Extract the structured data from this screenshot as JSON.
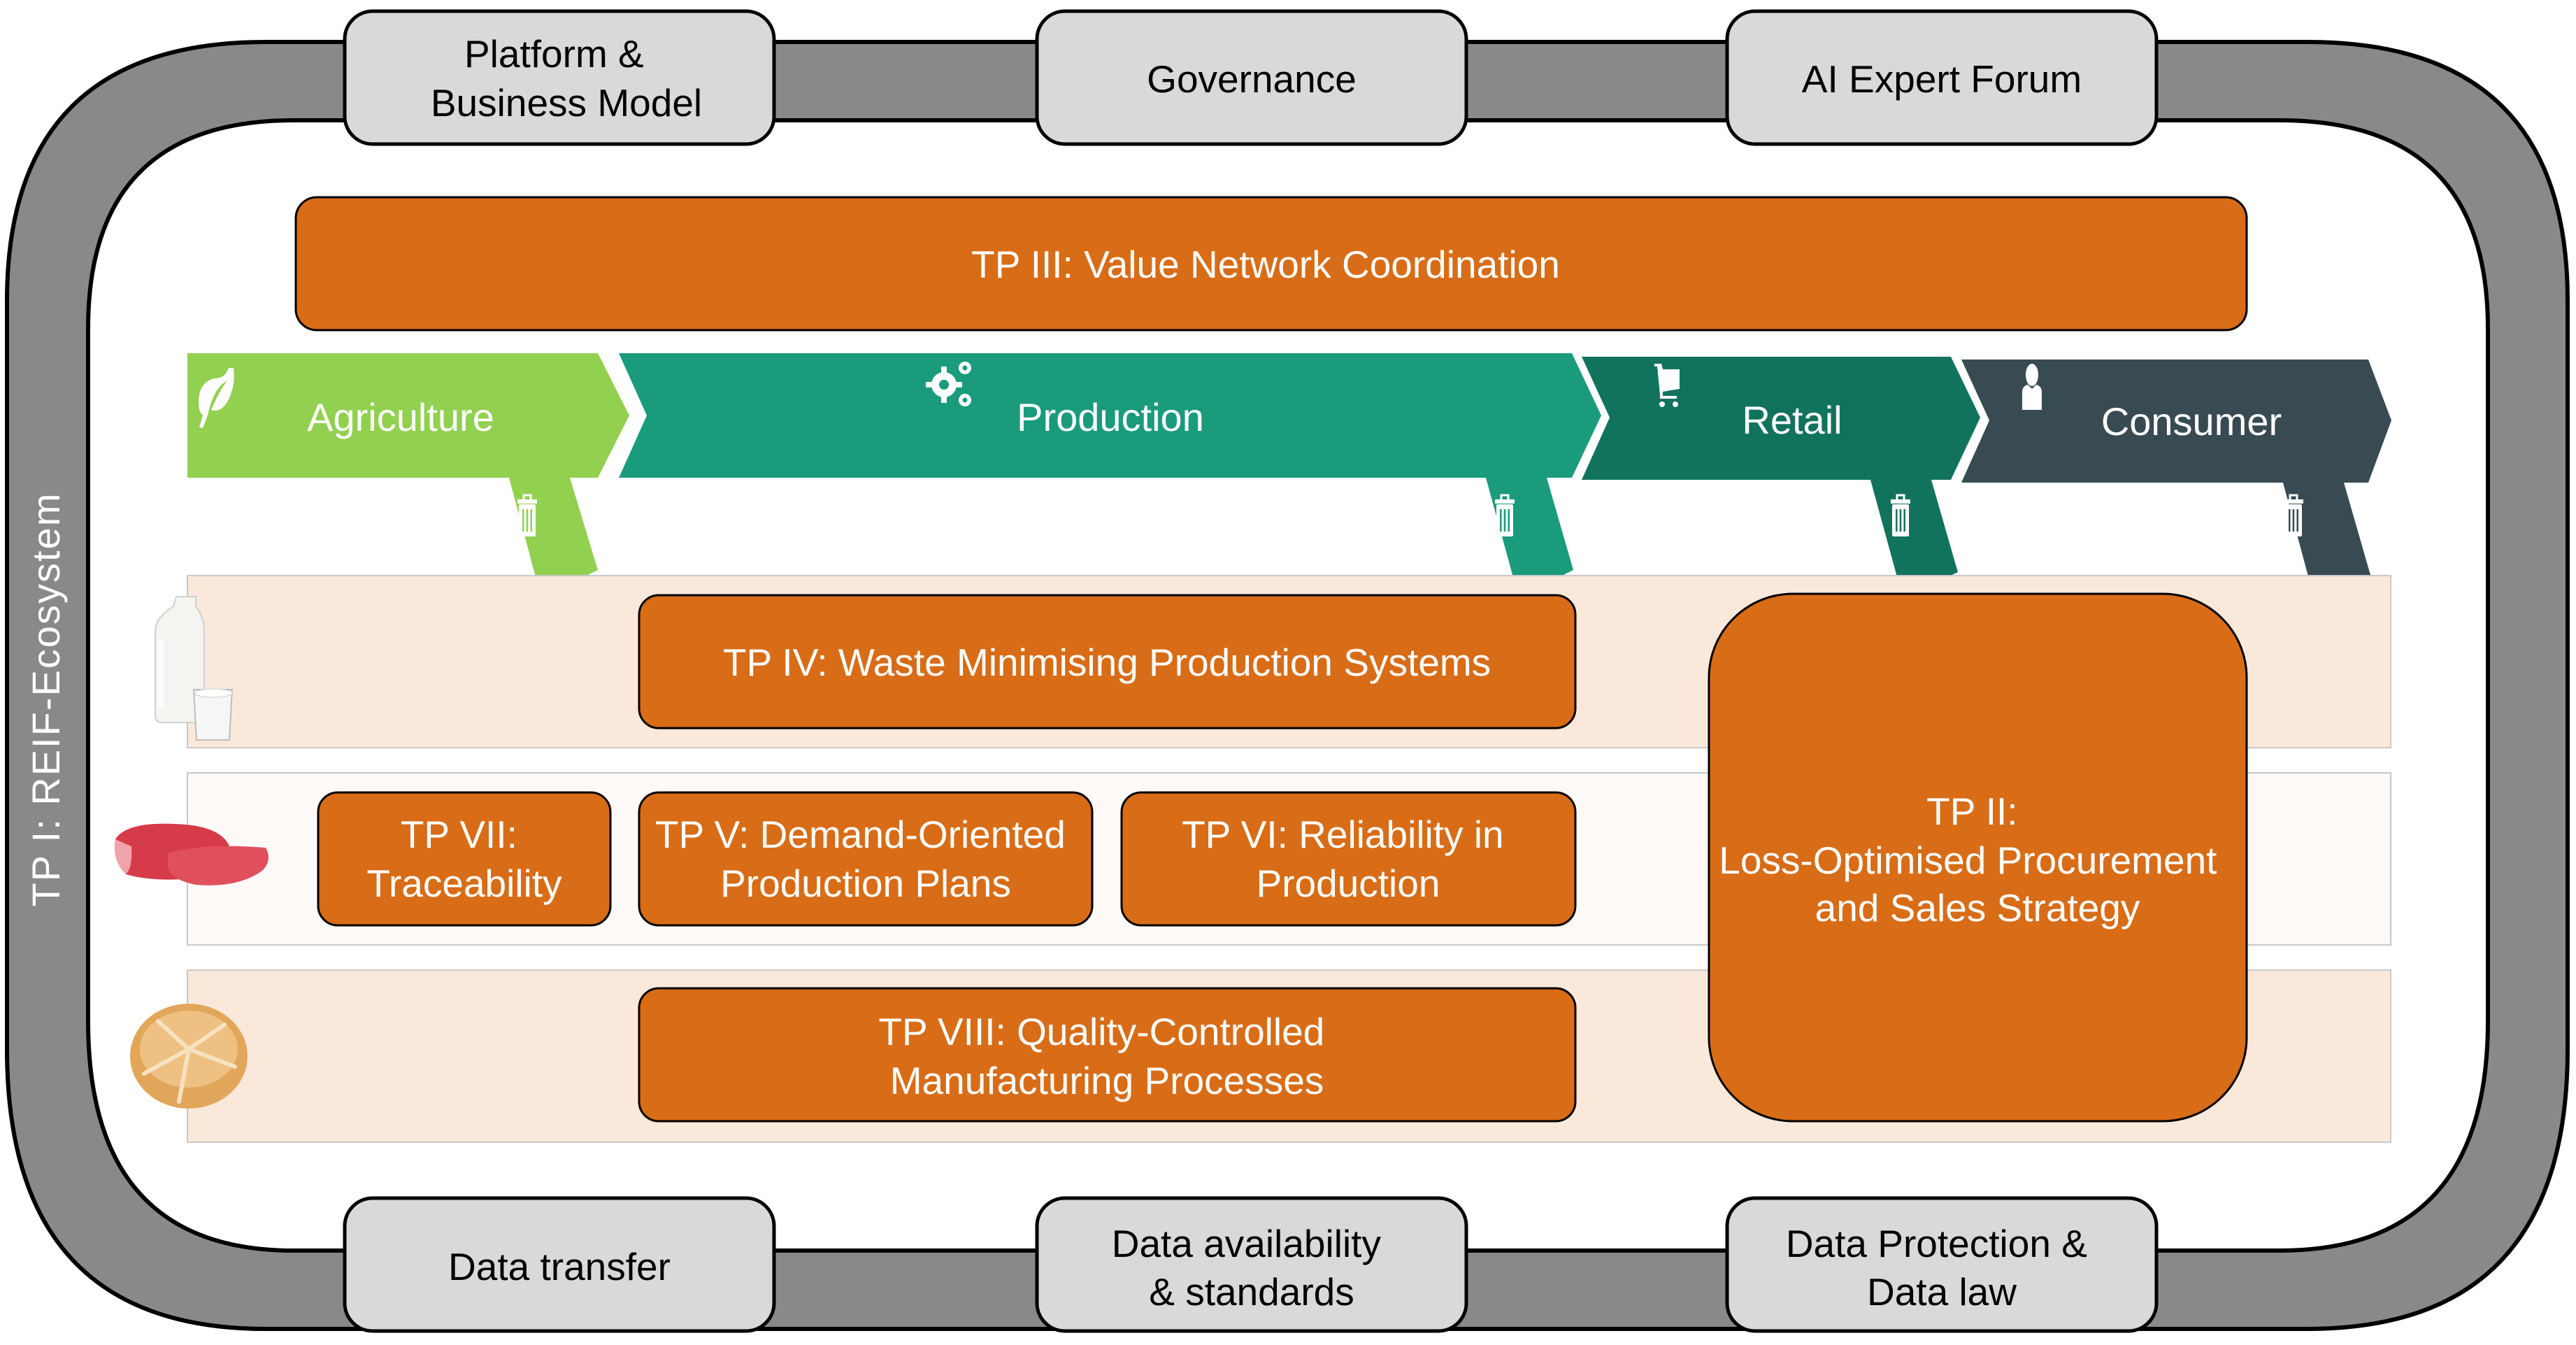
{
  "ecosystem_ring": {
    "label": "TP I: REIF-Ecosystem",
    "color": "#898989",
    "top_boxes": [
      {
        "lines": [
          "Platform &",
          "Business Model"
        ]
      },
      {
        "lines": [
          "Governance"
        ]
      },
      {
        "lines": [
          "AI Expert Forum"
        ]
      }
    ],
    "bottom_boxes": [
      {
        "lines": [
          "Data transfer"
        ]
      },
      {
        "lines": [
          "Data availability",
          "& standards"
        ]
      },
      {
        "lines": [
          "Data Protection &",
          "Data law"
        ]
      }
    ],
    "box_color": "#d9d9d9"
  },
  "value_network": {
    "lines": [
      "TP III: Value Network Coordination"
    ],
    "color": "#d86c17"
  },
  "stages": [
    {
      "label": "Agriculture",
      "icon": "leaf-icon",
      "waste_icon": "trash-icon",
      "color": "#92d050"
    },
    {
      "label": "Production",
      "icon": "gears-icon",
      "waste_icon": "trash-icon",
      "color": "#199b7c"
    },
    {
      "label": "Retail",
      "icon": "shopping-cart-icon",
      "waste_icon": "trash-icon",
      "color": "#12735c"
    },
    {
      "label": "Consumer",
      "icon": "user-icon",
      "waste_icon": "trash-icon",
      "color": "#384a52"
    }
  ],
  "product_rows": [
    {
      "product": "milk",
      "image": "milk-bottle-and-glass",
      "background": "#fae9db"
    },
    {
      "product": "meat",
      "image": "raw-meat",
      "background": "#fffaf7"
    },
    {
      "product": "bread",
      "image": "bread-roll",
      "background": "#fae9db"
    }
  ],
  "subprojects": {
    "tp4": {
      "lines": [
        "TP IV: Waste Minimising Production Systems"
      ]
    },
    "tp7": {
      "lines": [
        "TP VII:",
        "Traceability"
      ]
    },
    "tp5": {
      "lines": [
        "TP V: Demand-Oriented",
        "Production Plans"
      ]
    },
    "tp6": {
      "lines": [
        "TP VI: Reliability in",
        "Production"
      ]
    },
    "tp8": {
      "lines": [
        "TP VIII: Quality-Controlled",
        "Manufacturing Processes"
      ]
    },
    "tp2": {
      "lines": [
        "TP II:",
        "Loss-Optimised Procurement",
        "and Sales Strategy"
      ]
    }
  }
}
